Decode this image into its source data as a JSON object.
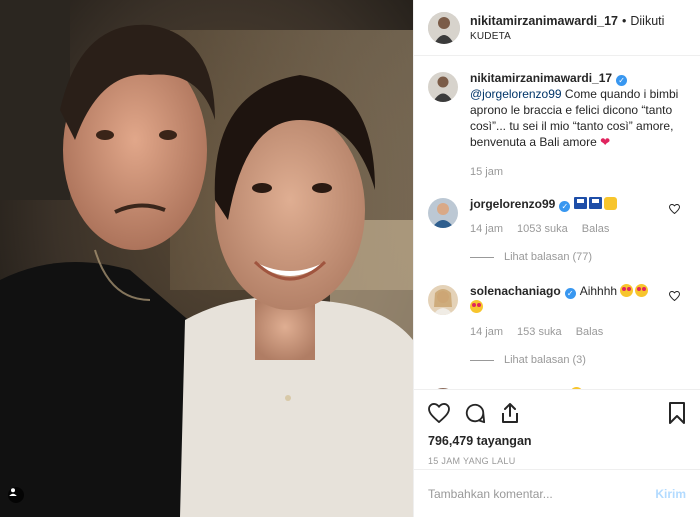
{
  "header": {
    "username": "nikitamirzanimawardi_17",
    "separator": "•",
    "follow_label": "Diikuti",
    "location": "KUDETA"
  },
  "caption": {
    "username": "nikitamirzanimawardi_17",
    "mention": "@jorgelorenzo99",
    "text": " Come quando i bimbi aprono le braccia e felici dicono “tanto così”... tu sei il mio “tanto così” amore, benvenuta a Bali amore ",
    "time": "15 jam"
  },
  "comments": [
    {
      "username": "jorgelorenzo99",
      "verified": true,
      "text": "",
      "time": "14 jam",
      "likes": "1053 suka",
      "reply_label": "Balas",
      "view_replies": "Lihat balasan (77)"
    },
    {
      "username": "solenachaniago",
      "verified": true,
      "text": "Aihhhh",
      "time": "14 jam",
      "likes": "153 suka",
      "reply_label": "Balas",
      "view_replies": "Lihat balasan (3)"
    },
    {
      "username": "malvianobertoldi",
      "verified": false,
      "text": ""
    }
  ],
  "actions": {
    "views": "796,479 tayangan",
    "posted_ago": "15 JAM YANG LALU"
  },
  "comment_box": {
    "placeholder": "Tambahkan komentar...",
    "post_label": "Kirim"
  },
  "icons": [
    "user-tag-icon",
    "heart-icon",
    "comment-icon",
    "share-icon",
    "bookmark-icon",
    "verified-badge-icon",
    "small-heart-icon"
  ],
  "colors": {
    "link": "#003569",
    "verified": "#3897f0",
    "muted": "#999999",
    "post_button_disabled": "#b3dbff"
  }
}
